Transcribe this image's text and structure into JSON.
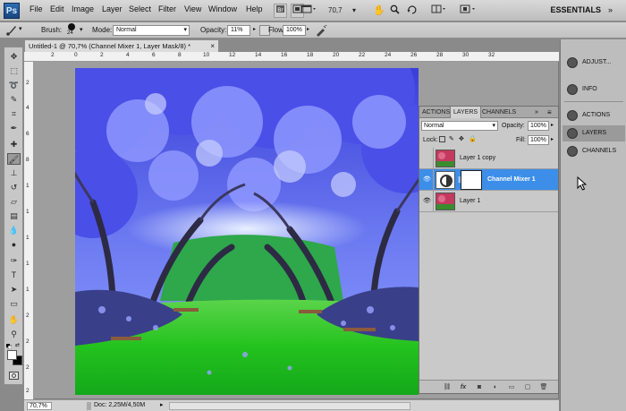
{
  "app": {
    "logo": "Ps"
  },
  "menu": [
    "File",
    "Edit",
    "Image",
    "Layer",
    "Select",
    "Filter",
    "View",
    "Window",
    "Help"
  ],
  "menubar": {
    "zoom": "70,7",
    "workspace": "ESSENTIALS",
    "icons": [
      "bridge-icon",
      "minibridge-icon",
      "screen-mode-icon",
      "hand-icon",
      "zoom-icon",
      "rotate-icon",
      "arrange-icon",
      "extras-icon"
    ]
  },
  "options": {
    "brush_label": "Brush:",
    "brush_size": "24",
    "mode_label": "Mode:",
    "mode_value": "Normal",
    "opacity_label": "Opacity:",
    "opacity_value": "11%",
    "flow_label": "Flow:",
    "flow_value": "100%"
  },
  "document": {
    "tab_title": "Untitled-1 @ 70,7% (Channel Mixer 1, Layer Mask/8) *",
    "ruler_h": [
      "2",
      "0",
      "2",
      "4",
      "6",
      "8",
      "10",
      "12",
      "14",
      "16",
      "18",
      "20",
      "22",
      "24",
      "26",
      "28",
      "30",
      "32"
    ],
    "ruler_v": [
      "2",
      "4",
      "6",
      "8",
      "1",
      "1",
      "1",
      "1",
      "1",
      "2",
      "2",
      "2",
      "2"
    ],
    "status_zoom": "70,7%",
    "status_doc": "Doc: 2,25M/4,50M"
  },
  "dock": {
    "items": [
      {
        "label": "ADJUST...",
        "icon": "adjustments-icon"
      },
      {
        "label": "INFO",
        "icon": "info-icon"
      },
      {
        "label": "ACTIONS",
        "icon": "actions-icon"
      },
      {
        "label": "LAYERS",
        "icon": "layers-icon"
      },
      {
        "label": "CHANNELS",
        "icon": "channels-icon"
      }
    ]
  },
  "layers_panel": {
    "tabs": [
      "ACTIONS",
      "LAYERS",
      "CHANNELS"
    ],
    "blend_mode": "Normal",
    "opacity_label": "Opacity:",
    "opacity_value": "100%",
    "lock_label": "Lock:",
    "fill_label": "Fill:",
    "fill_value": "100%",
    "layers": [
      {
        "name": "Layer 1 copy",
        "visible": false,
        "selected": false
      },
      {
        "name": "Channel Mixer 1",
        "visible": true,
        "selected": true
      },
      {
        "name": "Layer 1",
        "visible": true,
        "selected": false
      }
    ],
    "footer_icons": [
      "link-icon",
      "fx-icon",
      "mask-icon",
      "adjustment-icon",
      "group-icon",
      "new-layer-icon",
      "trash-icon"
    ]
  },
  "colors": {
    "selection": "#3d8ee8",
    "panel_bg": "#c9c9c9",
    "workspace_bg": "#9e9e9e"
  }
}
